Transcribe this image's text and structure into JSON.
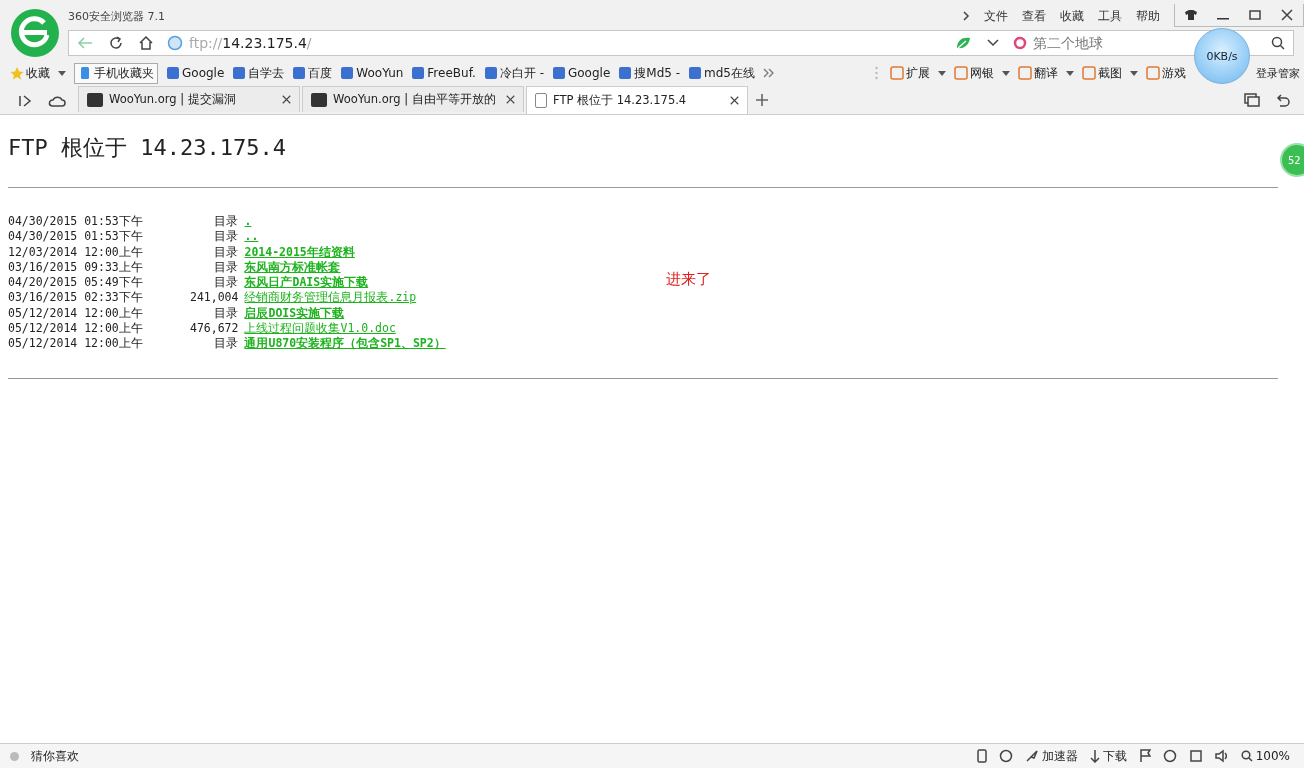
{
  "window": {
    "title": "360安全浏览器 7.1",
    "menu": [
      "文件",
      "查看",
      "收藏",
      "工具",
      "帮助"
    ]
  },
  "address_bar": {
    "scheme": "ftp://",
    "host": "14.23.175.4",
    "path": "/"
  },
  "search": {
    "placeholder": "第二个地球"
  },
  "speed": "0KB/s",
  "bookmarks": [
    {
      "label": "收藏",
      "kind": "menu"
    },
    {
      "label": "手机收藏夹",
      "kind": "boxed"
    },
    {
      "label": "Google",
      "kind": "link"
    },
    {
      "label": "自学去",
      "kind": "link"
    },
    {
      "label": "百度",
      "kind": "link"
    },
    {
      "label": "WooYun",
      "kind": "link"
    },
    {
      "label": "FreeBuf.",
      "kind": "link"
    },
    {
      "label": "冷白开 -",
      "kind": "link"
    },
    {
      "label": "Google",
      "kind": "link"
    },
    {
      "label": "搜Md5 -",
      "kind": "link"
    },
    {
      "label": "md5在线",
      "kind": "link"
    }
  ],
  "tools": [
    {
      "label": "扩展",
      "dropdown": true
    },
    {
      "label": "网银",
      "dropdown": true
    },
    {
      "label": "翻译",
      "dropdown": true
    },
    {
      "label": "截图",
      "dropdown": true
    },
    {
      "label": "游戏",
      "dropdown": false
    },
    {
      "label": "登录管家",
      "dropdown": false
    }
  ],
  "tabs": [
    {
      "label": "WooYun.org | 提交漏洞",
      "selected": false
    },
    {
      "label": "WooYun.org | 自由平等开放的",
      "selected": false
    },
    {
      "label": "FTP 根位于 14.23.175.4",
      "selected": true
    }
  ],
  "page": {
    "heading": "FTP 根位于 14.23.175.4",
    "note": "进来了",
    "side_badge": "52",
    "listing": [
      {
        "date": "04/30/2015",
        "time": "01:53下午",
        "kind": "dir",
        "size": "目录",
        "name": "."
      },
      {
        "date": "04/30/2015",
        "time": "01:53下午",
        "kind": "dir",
        "size": "目录",
        "name": ".."
      },
      {
        "date": "12/03/2014",
        "time": "12:00上午",
        "kind": "dir",
        "size": "目录",
        "name": "2014-2015年结资料"
      },
      {
        "date": "03/16/2015",
        "time": "09:33上午",
        "kind": "dir",
        "size": "目录",
        "name": "东风南方标准帐套"
      },
      {
        "date": "04/20/2015",
        "time": "05:49下午",
        "kind": "dir",
        "size": "目录",
        "name": "东风日产DAIS实施下载"
      },
      {
        "date": "03/16/2015",
        "time": "02:33下午",
        "kind": "file",
        "size": "241,004",
        "name": "经销商财务管理信息月报表.zip"
      },
      {
        "date": "05/12/2014",
        "time": "12:00上午",
        "kind": "dir",
        "size": "目录",
        "name": "启辰DOIS实施下载"
      },
      {
        "date": "05/12/2014",
        "time": "12:00上午",
        "kind": "file",
        "size": "476,672",
        "name": "上线过程问题收集V1.0.doc"
      },
      {
        "date": "05/12/2014",
        "time": "12:00上午",
        "kind": "dir",
        "size": "目录",
        "name": "通用U870安装程序（包含SP1、SP2）"
      }
    ]
  },
  "status_bar": {
    "left": "猜你喜欢",
    "accelerator": "加速器",
    "download": "下载",
    "zoom": "100%"
  }
}
